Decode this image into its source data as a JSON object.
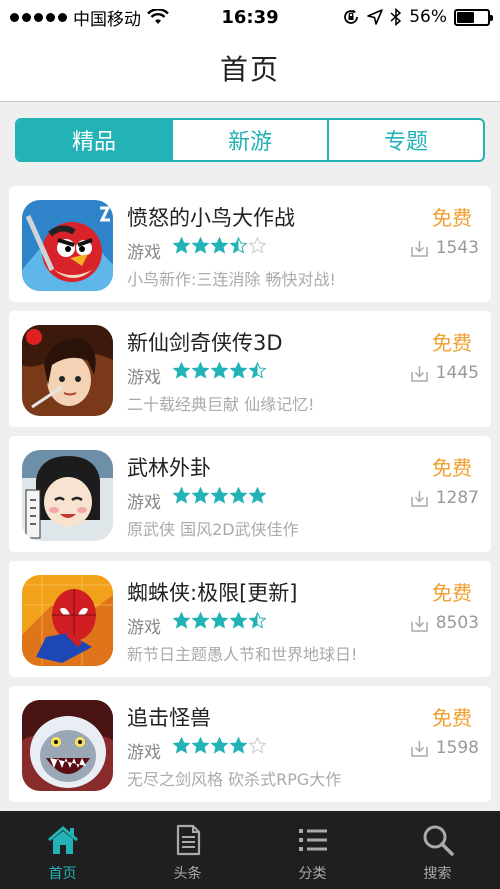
{
  "status_bar": {
    "carrier": "中国移动",
    "time": "16:39",
    "battery": "56%",
    "battery_level": 0.56,
    "icons": [
      "signal-dots",
      "wifi-icon",
      "rotation-lock-icon",
      "location-icon",
      "bluetooth-icon",
      "battery-icon"
    ]
  },
  "nav": {
    "title": "首页"
  },
  "segments": [
    {
      "label": "精品",
      "active": true
    },
    {
      "label": "新游",
      "active": false
    },
    {
      "label": "专题",
      "active": false
    }
  ],
  "apps": [
    {
      "name": "愤怒的小鸟大作战",
      "category": "游戏",
      "rating": 3.5,
      "description": "小鸟新作:三连消除 畅快对战!",
      "price": "免费",
      "downloads": "1543",
      "icon": "angry-birds-icon"
    },
    {
      "name": "新仙剑奇侠传3D",
      "category": "游戏",
      "rating": 4.5,
      "description": "二十载经典巨献 仙缘记忆!",
      "price": "免费",
      "downloads": "1445",
      "icon": "xianjian-icon"
    },
    {
      "name": "武林外卦",
      "category": "游戏",
      "rating": 5,
      "description": "原武侠 国风2D武侠佳作",
      "price": "免费",
      "downloads": "1287",
      "icon": "wulin-icon"
    },
    {
      "name": "蜘蛛侠:极限[更新]",
      "category": "游戏",
      "rating": 4.5,
      "description": "新节日主题愚人节和世界地球日!",
      "price": "免费",
      "downloads": "8503",
      "icon": "spiderman-icon"
    },
    {
      "name": "追击怪兽",
      "category": "游戏",
      "rating": 4,
      "description": "无尽之剑风格 砍杀式RPG大作",
      "price": "免费",
      "downloads": "1598",
      "icon": "monster-icon"
    }
  ],
  "tabs": [
    {
      "label": "首页",
      "icon": "home-icon",
      "active": true
    },
    {
      "label": "头条",
      "icon": "document-icon",
      "active": false
    },
    {
      "label": "分类",
      "icon": "list-icon",
      "active": false
    },
    {
      "label": "搜索",
      "icon": "search-icon",
      "active": false
    }
  ],
  "colors": {
    "accent": "#23b3b6",
    "price": "#f0a030",
    "tabbar": "#1f1f1f",
    "background": "#efefef"
  }
}
